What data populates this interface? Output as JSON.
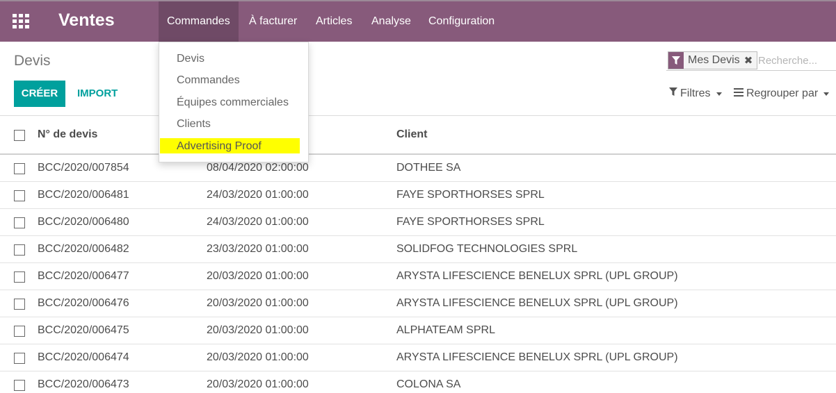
{
  "navbar": {
    "app_title": "Ventes",
    "apps_icon": "grid-icon",
    "menu": [
      "Commandes",
      "À facturer",
      "Articles",
      "Analyse",
      "Configuration"
    ],
    "active_menu": "Commandes",
    "color": "#875a7b"
  },
  "dropdown": {
    "items": [
      "Devis",
      "Commandes",
      "Équipes commerciales",
      "Clients",
      "Advertising Proof"
    ],
    "highlighted": "Advertising Proof",
    "highlight_color": "#ffff00"
  },
  "control_panel": {
    "title": "Devis",
    "create_label": "CRÉER",
    "import_label": "IMPORT",
    "accent_color": "#00a09d",
    "facet_label": "Mes Devis",
    "facet_icon": "filter-icon",
    "facet_close_icon": "close-icon",
    "search_placeholder": "Recherche...",
    "filters_label": "Filtres",
    "groupby_label": "Regrouper par"
  },
  "table": {
    "headers": [
      "N° de devis",
      "",
      "Client"
    ],
    "rows": [
      {
        "num": "BCC/2020/007854",
        "date": "08/04/2020 02:00:00",
        "client": "DOTHEE SA"
      },
      {
        "num": "BCC/2020/006481",
        "date": "24/03/2020 01:00:00",
        "client": "FAYE SPORTHORSES SPRL"
      },
      {
        "num": "BCC/2020/006480",
        "date": "24/03/2020 01:00:00",
        "client": "FAYE SPORTHORSES SPRL"
      },
      {
        "num": "BCC/2020/006482",
        "date": "23/03/2020 01:00:00",
        "client": "SOLIDFOG TECHNOLOGIES SPRL"
      },
      {
        "num": "BCC/2020/006477",
        "date": "20/03/2020 01:00:00",
        "client": "ARYSTA LIFESCIENCE BENELUX SPRL (UPL GROUP)"
      },
      {
        "num": "BCC/2020/006476",
        "date": "20/03/2020 01:00:00",
        "client": "ARYSTA LIFESCIENCE BENELUX SPRL (UPL GROUP)"
      },
      {
        "num": "BCC/2020/006475",
        "date": "20/03/2020 01:00:00",
        "client": "ALPHATEAM SPRL"
      },
      {
        "num": "BCC/2020/006474",
        "date": "20/03/2020 01:00:00",
        "client": "ARYSTA LIFESCIENCE BENELUX SPRL (UPL GROUP)"
      },
      {
        "num": "BCC/2020/006473",
        "date": "20/03/2020 01:00:00",
        "client": "COLONA SA"
      }
    ]
  }
}
